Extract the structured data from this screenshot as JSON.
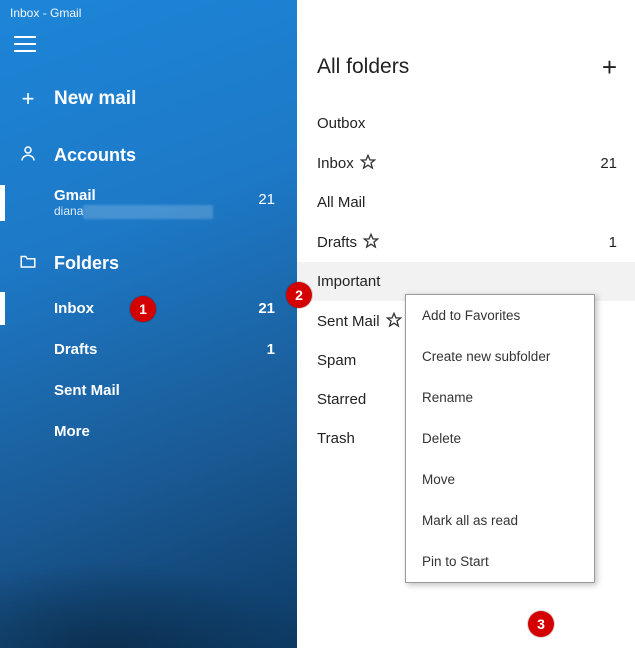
{
  "window_title": "Inbox - Gmail",
  "sidebar": {
    "new_mail_label": "New mail",
    "accounts_label": "Accounts",
    "folders_label": "Folders",
    "account": {
      "name": "Gmail",
      "email": "diana",
      "unread": "21"
    },
    "folders": [
      {
        "label": "Inbox",
        "count": "21",
        "selected": true
      },
      {
        "label": "Drafts",
        "count": "1"
      },
      {
        "label": "Sent Mail"
      },
      {
        "label": "More"
      }
    ]
  },
  "main": {
    "all_folders_label": "All folders",
    "folders": [
      {
        "label": "Outbox"
      },
      {
        "label": "Inbox",
        "star": true,
        "count": "21"
      },
      {
        "label": "All Mail"
      },
      {
        "label": "Drafts",
        "star": true,
        "count": "1"
      },
      {
        "label": "Important",
        "highlight": true
      },
      {
        "label": "Sent Mail",
        "star": true
      },
      {
        "label": "Spam"
      },
      {
        "label": "Starred"
      },
      {
        "label": "Trash"
      }
    ]
  },
  "context_menu": [
    "Add to Favorites",
    "Create new subfolder",
    "Rename",
    "Delete",
    "Move",
    "Mark all as read",
    "Pin to Start"
  ],
  "markers": {
    "1": "1",
    "2": "2",
    "3": "3"
  }
}
